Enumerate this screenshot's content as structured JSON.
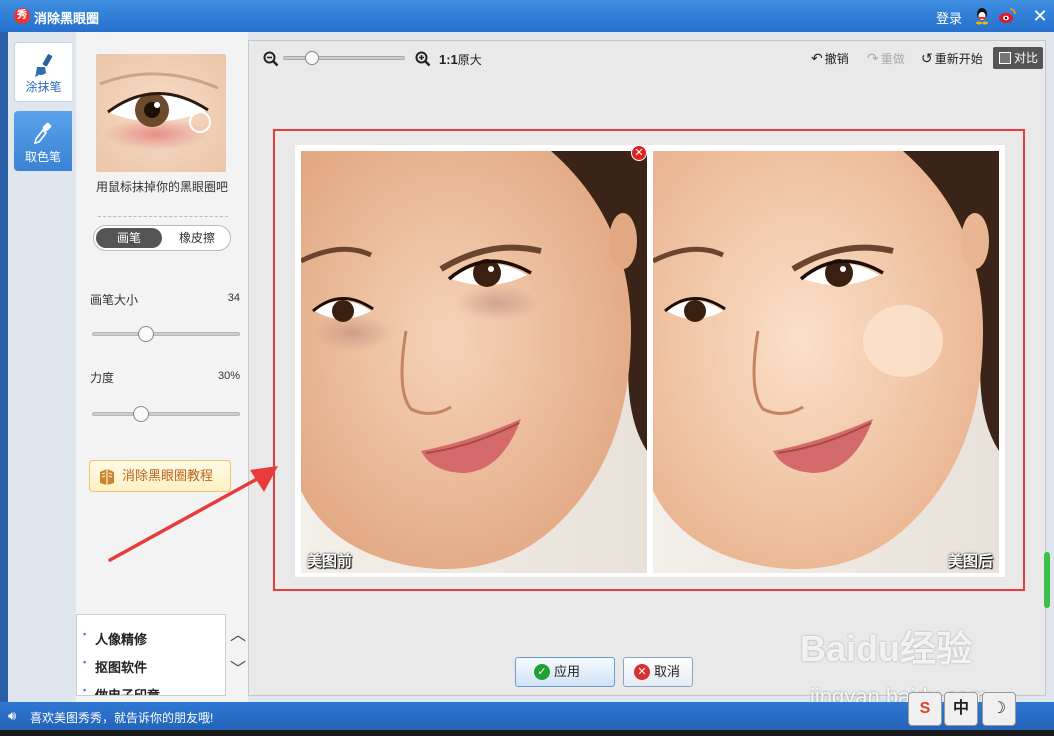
{
  "titlebar": {
    "logo": "秀",
    "title": "消除黑眼圈",
    "login": "登录",
    "icons": [
      "qq-icon",
      "weibo-icon",
      "close-icon"
    ]
  },
  "tools": [
    {
      "label": "涂抹笔",
      "icon": "brush-icon",
      "active": true
    },
    {
      "label": "取色笔",
      "icon": "eyedropper-icon",
      "active": false
    }
  ],
  "panel": {
    "hint": "用鼠标抹掉你的黑眼圈吧",
    "modes": {
      "brush": "画笔",
      "eraser": "橡皮擦",
      "active": "brush"
    },
    "brush_size": {
      "label": "画笔大小",
      "value": "34",
      "level": 0.34
    },
    "strength": {
      "label": "力度",
      "value": "30%",
      "level": 0.3
    },
    "tutorial": "消除黑眼圈教程"
  },
  "bottom_list": {
    "items": [
      "人像精修",
      "抠图软件",
      "做电子印章"
    ]
  },
  "toolbar": {
    "ratio_bold": "1:1",
    "ratio_text": "原大",
    "undo": "撤销",
    "redo": "重做",
    "reset": "重新开始",
    "compare": "对比",
    "zoom_level": 0.2
  },
  "photos": {
    "before_label": "美图前",
    "after_label": "美图后"
  },
  "buttons": {
    "apply": "应用",
    "cancel": "取消"
  },
  "status": {
    "text": "喜欢美图秀秀，就告诉你的朋友哦!"
  },
  "watermark": {
    "brand": "Baidu经验",
    "url": "jingyan.baidu.com"
  },
  "ime": {
    "s": "S",
    "zh": "中",
    "moon": "☽"
  },
  "colors": {
    "accent_blue": "#2470cc",
    "annotation_red": "#e83b3b",
    "apply_green": "#22a033"
  }
}
